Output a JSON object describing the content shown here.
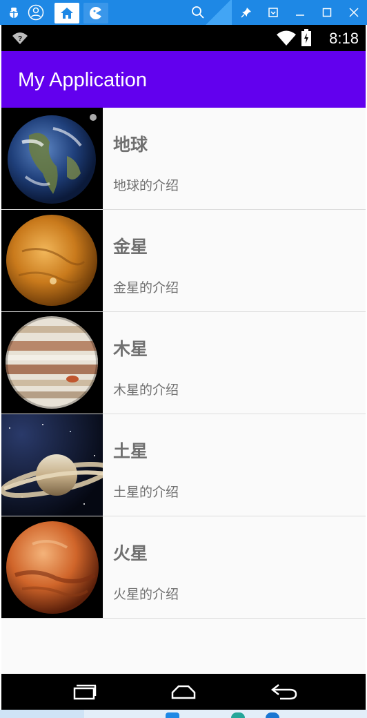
{
  "colors": {
    "emulator_bar": "#1e88e5",
    "app_bar": "#6200ee",
    "status_bar": "#000000",
    "text": "#707070"
  },
  "emulator": {
    "icons": [
      "debug-icon",
      "user-icon",
      "home-tab-icon",
      "app-tab-icon",
      "search-icon",
      "pin-icon",
      "collapse-icon",
      "minimize-icon",
      "maximize-icon",
      "close-icon"
    ]
  },
  "status_bar": {
    "time": "8:18"
  },
  "app_bar": {
    "title": "My Application"
  },
  "planets": [
    {
      "name": "地球",
      "desc": "地球的介绍",
      "image": "earth"
    },
    {
      "name": "金星",
      "desc": "金星的介绍",
      "image": "venus"
    },
    {
      "name": "木星",
      "desc": "木星的介绍",
      "image": "jupiter"
    },
    {
      "name": "土星",
      "desc": "土星的介绍",
      "image": "saturn"
    },
    {
      "name": "火星",
      "desc": "火星的介绍",
      "image": "mars"
    }
  ],
  "nav_bar": {
    "buttons": [
      "recents-icon",
      "home-icon",
      "back-icon"
    ]
  }
}
